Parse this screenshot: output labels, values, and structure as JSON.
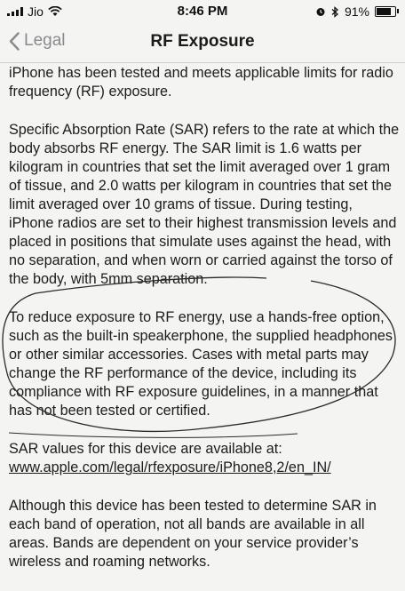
{
  "status_bar": {
    "carrier": "Jio",
    "time": "8:46 PM",
    "battery_percent": "91%",
    "battery_level": 0.91
  },
  "nav": {
    "back_label": "Legal",
    "title": "RF Exposure"
  },
  "content": {
    "paragraph_1": "iPhone has been tested and meets applicable limits for radio frequency (RF) exposure.",
    "paragraph_2": "Specific Absorption Rate (SAR) refers to the rate at which the body absorbs RF energy. The SAR limit is 1.6 watts per kilogram in countries that set the limit averaged over 1 gram of tissue, and 2.0 watts per kilogram in countries that set the limit averaged over 10 grams of tissue. During testing, iPhone radios are set to their highest transmission levels and placed in positions that simulate uses against the head, with no separation, and when worn or carried against the torso of the body, with 5mm separation.",
    "paragraph_3": "To reduce exposure to RF energy, use a hands-free option, such as the built-in speakerphone, the supplied headphones or other similar accessories. Cases with metal parts may change the RF performance of the device, including its compliance with RF exposure guidelines, in a manner that has not been tested or certified.",
    "sar_text": "SAR values for this device are available at:",
    "sar_link": "www.apple.com/legal/rfexposure/iPhone8,2/en_IN/",
    "paragraph_5": "Although this device has been tested to determine SAR in each band of operation, not all bands are available in all areas. Bands are dependent on your service provider’s wireless and roaming networks."
  }
}
